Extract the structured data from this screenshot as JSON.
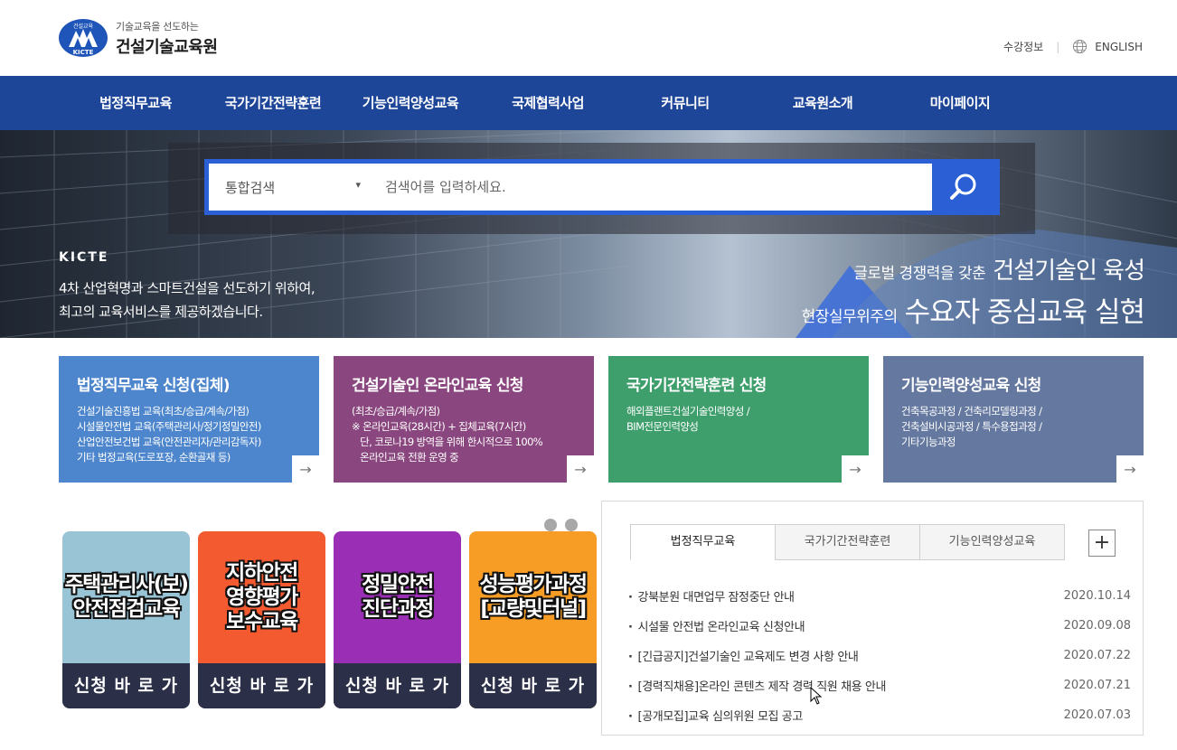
{
  "header": {
    "logo_badge_top": "건설교육",
    "logo_badge_bottom": "KICTE",
    "logo_sub": "기술교육을 선도하는",
    "logo_name": "건설기술교육원",
    "util_course_info": "수강정보",
    "util_separator": "|",
    "util_english": "ENGLISH"
  },
  "nav": {
    "items": [
      "법정직무교육",
      "국가기간전략훈련",
      "기능인력양성교육",
      "국제협력사업",
      "커뮤니티",
      "교육원소개",
      "마이페이지"
    ]
  },
  "search": {
    "category": "통합검색",
    "placeholder": "검색어를 입력하세요.",
    "value": ""
  },
  "hero": {
    "brand": "KICTE",
    "desc_line1": "4차 산업혁명과 스마트건설을 선도하기 위하여,",
    "desc_line2": "최고의 교육서비스를 제공하겠습니다.",
    "right1_small": "글로벌 경쟁력을 갖춘",
    "right1_big": "건설기술인 육성",
    "right2_small": "현장실무위주의",
    "right2_big": "수요자 중심교육 실현"
  },
  "cards": [
    {
      "title": "법정직무교육 신청(집체)",
      "lines": [
        "건설기술진흥법 교육(최초/승급/계속/가점)",
        "시설물안전법 교육(주택관리사/정기정밀안전)",
        "산업안전보건법 교육(안전관리자/관리감독자)",
        "기타 법정교육(도로포장, 순환골재 등)"
      ]
    },
    {
      "title": "건설기술인 온라인교육 신청",
      "lines": [
        "(최초/승급/계속/가점)",
        "※ 온라인교육(28시간) + 집체교육(7시간)",
        "   단, 코로나19 방역을 위해 한시적으로 100%",
        "   온라인교육 전환 운영 중"
      ]
    },
    {
      "title": "국가기간전략훈련 신청",
      "lines": [
        "해외플랜트건설기술인력양성 /",
        "BIM전문인력양성",
        "",
        ""
      ]
    },
    {
      "title": "기능인력양성교육 신청",
      "lines": [
        "건축목공과정 / 건축리모델링과정 /",
        "건축설비시공과정 / 특수용접과정 /",
        "기타기능과정",
        ""
      ]
    }
  ],
  "card_arrow": "→",
  "banners": [
    {
      "title_l1": "주택관리사(보)",
      "title_l2": "안전점검교육",
      "title_l3": "",
      "button": "신청 바 로 가 기"
    },
    {
      "title_l1": "지하안전",
      "title_l2": "영향평가",
      "title_l3": "보수교육",
      "button": "신청 바 로 가 기"
    },
    {
      "title_l1": "정밀안전",
      "title_l2": "진단과정",
      "title_l3": "",
      "button": "신청 바 로 가 기"
    },
    {
      "title_l1": "성능평가과정",
      "title_l2": "[교량및터널]",
      "title_l3": "",
      "button": "신청 바 로 가 기"
    }
  ],
  "notice": {
    "tabs": [
      "법정직무교육",
      "국가기간전략훈련",
      "기능인력양성교육"
    ],
    "more_label": "+",
    "items": [
      {
        "title": "강북분원 대면업무 잠정중단 안내",
        "date": "2020.10.14"
      },
      {
        "title": "시설물 안전법 온라인교육 신청안내",
        "date": "2020.09.08"
      },
      {
        "title": "[긴급공지]건설기술인 교육제도 변경 사항 안내",
        "date": "2020.07.22"
      },
      {
        "title": "[경력직채용]온라인 콘텐츠 제작 경력 직원 채용 안내",
        "date": "2020.07.21"
      },
      {
        "title": "[공개모집]교육 심의위원 모집 공고",
        "date": "2020.07.03"
      }
    ]
  },
  "colors": {
    "nav_bg": "#1d4598",
    "search_accent": "#2b5fd6",
    "card1": "#4d86cc",
    "card2": "#8a467e",
    "card3": "#3f9f6c",
    "card4": "#6478a0"
  }
}
